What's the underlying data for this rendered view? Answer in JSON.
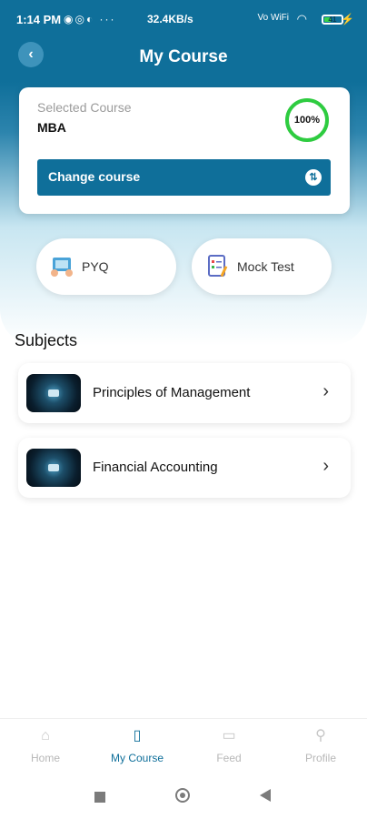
{
  "status_bar": {
    "time": "1:14 PM",
    "notification_icons": [
      "whatsapp-icon",
      "instagram-icon",
      "app-icon",
      "more-icon"
    ],
    "network_speed": "32.4KB/s",
    "network_labels": "Vo WiFi",
    "battery": "41"
  },
  "header": {
    "title": "My Course",
    "back_icon": "back-arrow-icon"
  },
  "course_card": {
    "label": "Selected Course",
    "course_name": "MBA",
    "progress_text": "100%",
    "progress_fraction": 1.0,
    "progress_color": "#2ecc40",
    "change_button_label": "Change course",
    "change_icon": "swap-icon"
  },
  "quick_actions": [
    {
      "label": "PYQ",
      "icon": "pyq-icon"
    },
    {
      "label": "Mock Test",
      "icon": "mock-test-icon"
    }
  ],
  "subjects": {
    "heading": "Subjects",
    "items": [
      {
        "title": "Principles of Management"
      },
      {
        "title": "Financial Accounting"
      }
    ]
  },
  "bottom_nav": {
    "items": [
      {
        "label": "Home",
        "icon": "home-icon",
        "active": false
      },
      {
        "label": "My Course",
        "icon": "book-icon",
        "active": true
      },
      {
        "label": "Feed",
        "icon": "feed-icon",
        "active": false
      },
      {
        "label": "Profile",
        "icon": "profile-icon",
        "active": false
      }
    ]
  },
  "colors": {
    "primary": "#0f6f9a",
    "progress": "#2ecc40"
  }
}
